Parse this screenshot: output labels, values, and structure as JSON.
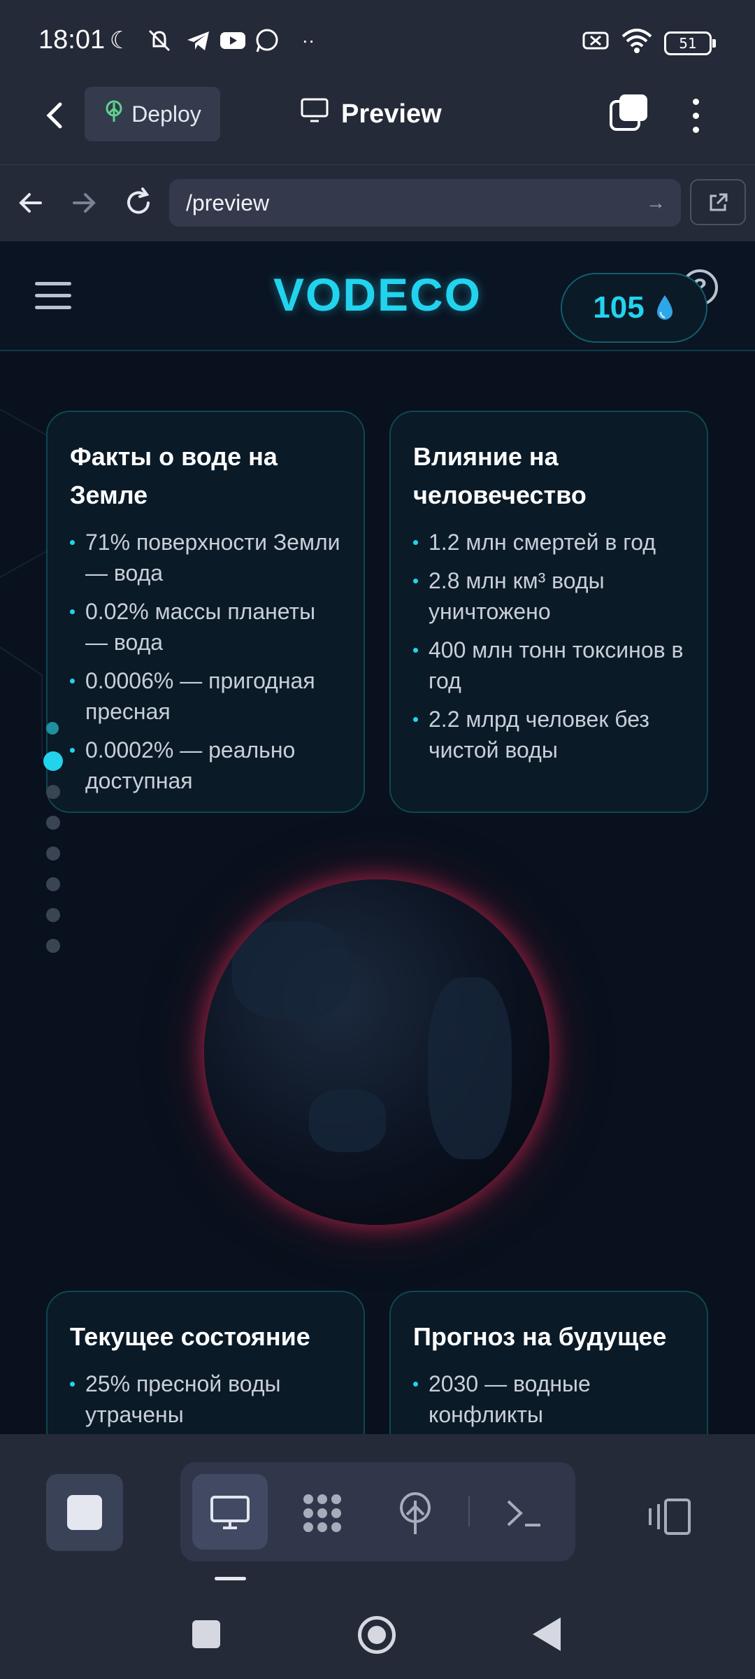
{
  "status_bar": {
    "time": "18:01",
    "battery": "51",
    "icons": [
      "moon-icon",
      "mute-icon",
      "telegram-icon",
      "youtube-icon",
      "whatsapp-icon",
      "more-dots-icon",
      "sim-off-icon",
      "wifi-icon",
      "battery-icon"
    ]
  },
  "app_bar": {
    "deploy_label": "Deploy",
    "title": "Preview"
  },
  "url_bar": {
    "url": "/preview"
  },
  "site": {
    "logo": "VODECO",
    "drops_count": "105",
    "cards": [
      {
        "title": "Факты о воде на Земле",
        "items": [
          "71% поверхности Земли — вода",
          "0.02% массы планеты — вода",
          "0.0006% — пригодная пресная",
          "0.0002% — реально доступная"
        ]
      },
      {
        "title": "Влияние на человечество",
        "items": [
          "1.2 млн смертей в год",
          "2.8 млн км³ воды уничтожено",
          "400 млн тонн токсинов в год",
          "2.2 млрд человек без чистой воды"
        ]
      },
      {
        "title": "Текущее состояние",
        "items": [
          "25% пресной воды утрачены"
        ]
      },
      {
        "title": "Прогноз на будущее",
        "items": [
          "2030 — водные конфликты"
        ]
      }
    ],
    "pager": {
      "total": 8,
      "active": 2
    }
  },
  "accent_color": "#22d3ee",
  "glow_color": "#d22850"
}
